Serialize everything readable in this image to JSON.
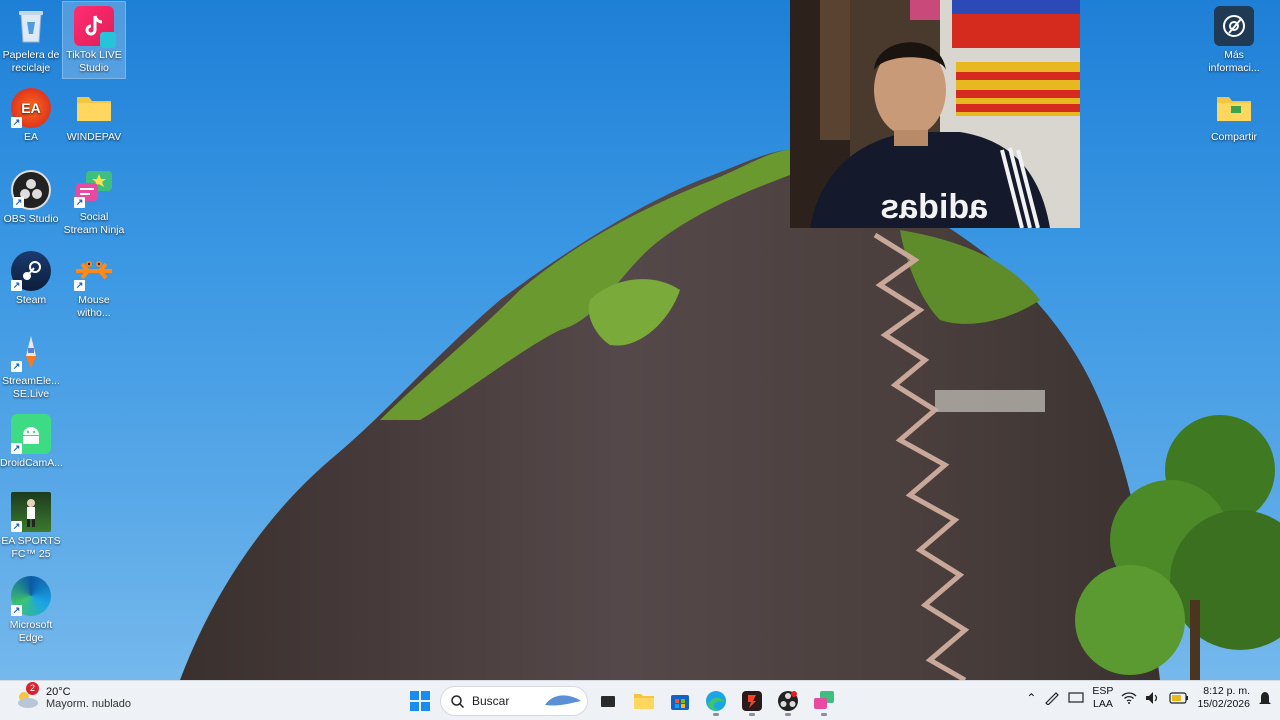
{
  "desktop": {
    "left_column": [
      {
        "label": "Papelera de reciclaje",
        "icon": "recycle-bin-icon"
      },
      {
        "label": "EA",
        "icon": "ea-icon"
      },
      {
        "label": "OBS Studio",
        "icon": "obs-icon"
      },
      {
        "label": "Steam",
        "icon": "steam-icon"
      },
      {
        "label": "StreamEle... SE.Live",
        "icon": "streamelements-icon"
      },
      {
        "label": "DroidCamA...",
        "icon": "droidcam-icon"
      },
      {
        "label": "EA SPORTS FC™ 25",
        "icon": "ea-fc-icon"
      },
      {
        "label": "Microsoft Edge",
        "icon": "edge-icon"
      }
    ],
    "second_column": [
      {
        "label": "TikTok LIVE Studio",
        "icon": "tiktok-live-icon"
      },
      {
        "label": "WINDEPAV",
        "icon": "folder-icon"
      },
      {
        "label": "Social Stream Ninja",
        "icon": "social-stream-icon"
      },
      {
        "label": "Mouse witho...",
        "icon": "mouse-without-borders-icon"
      }
    ],
    "right_column": [
      {
        "label": "Más informaci...",
        "icon": "info-camera-icon"
      },
      {
        "label": "Compartir",
        "icon": "shared-folder-icon"
      }
    ]
  },
  "webcam": {
    "shirt_text": "adidas"
  },
  "taskbar": {
    "weather": {
      "badge": "2",
      "temp": "20°C",
      "desc": "Mayorm. nublado"
    },
    "search_label": "Buscar",
    "pinned": [
      "start-icon",
      "task-view-icon",
      "file-explorer-icon",
      "store-icon",
      "edge-icon",
      "app-red-icon",
      "obs-icon",
      "social-stream-icon"
    ],
    "tray": {
      "lang_top": "ESP",
      "lang_bottom": "LAA",
      "time": "8:12 p. m.",
      "date": "15/02/2026"
    }
  },
  "colors": {
    "sky": "#3a97e3",
    "taskbar": "#eef1f5",
    "rock": "#4a3e3a",
    "vegetation": "#6a9a2f"
  }
}
